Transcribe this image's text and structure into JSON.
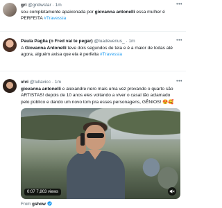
{
  "tweets": [
    {
      "name": "gri",
      "handle": "@gridwstar",
      "time": "1m",
      "text_before": "sou completamente apaixonada por ",
      "mention": "giovanna antonelli",
      "text_after": " essa mulher é PERFEITA ",
      "hashtag": "#Travessia"
    },
    {
      "name": "Paula Paglia (o Fred vai te pegar)",
      "handle": "@luadevenus_",
      "time": "1m",
      "text_before": "A ",
      "mention": "Giovanna Antonelli",
      "text_after": " teve dois segundos de tela e é a maior de todas até agora, alguém avisa que ela é perfeita ",
      "hashtag": "#Travessia"
    },
    {
      "name": "vivi",
      "handle": "@tullavicc",
      "time": "1m",
      "mention": "giovanna antonelli",
      "text_after": " e alexandre nero mais uma vez provando o quarto são ARTISTAS! depois de 10 anos eles voltando a viver o casal tão aclamado pelo público e dando um novo tom pra esses personagens, GÊNIOS! 😍🥰",
      "video": {
        "time_label": "0:07",
        "views_label": "7,803 views",
        "mute_icon": "speaker-muted-icon"
      },
      "from_label": "From",
      "from_source": "gshow",
      "from_source_icon": "verified-icon"
    }
  ],
  "more_icon": "more-dots-icon",
  "colors": {
    "link": "#1d9bf0",
    "text": "#0f1419",
    "muted": "#536471",
    "divider": "#eff3f4"
  }
}
